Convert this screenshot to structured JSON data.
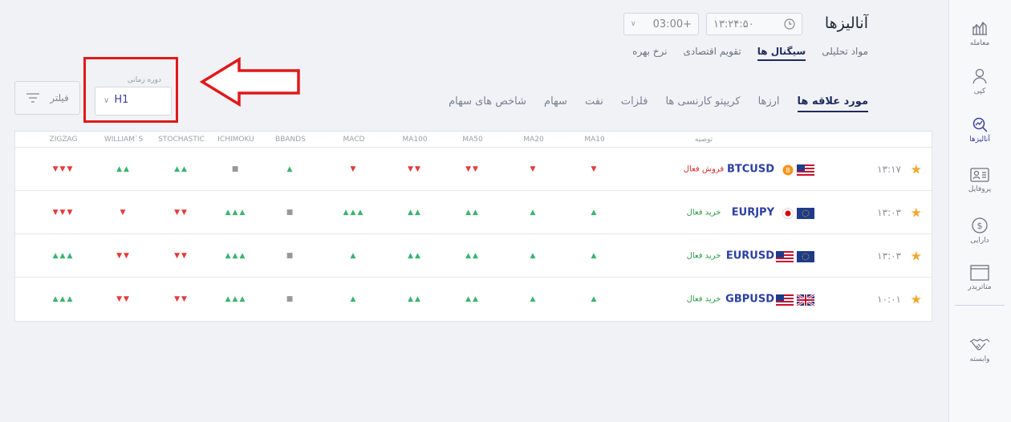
{
  "header": {
    "title": "آنالیزها",
    "clock": "۱۳:۲۴:۵۰",
    "timezone": "03:00+"
  },
  "top_tabs": [
    "مواد تحلیلی",
    "سیگنال ها",
    "تقویم اقتصادی",
    "نرخ بهره"
  ],
  "category_tabs": [
    "مورد علاقه ها",
    "ارزها",
    "کریپتو کارنسی ها",
    "فلزات",
    "نفت",
    "سهام",
    "شاخص های سهام"
  ],
  "filter": {
    "label": "فیلتر"
  },
  "period": {
    "label": "دوره زمانی",
    "value": "H1"
  },
  "table": {
    "headers": {
      "recommendation": "توصیه",
      "ma10": "MA10",
      "ma20": "MA20",
      "ma50": "MA50",
      "ma100": "MA100",
      "macd": "MACD",
      "bbands": "BBANDS",
      "ichimoku": "ICHIMOKU",
      "stochastic": "STOCHASTIC",
      "williams": "WILLIAM`S",
      "zigzag": "ZIGZAG"
    },
    "rows": [
      {
        "time": "۱۳:۱۷",
        "symbol": "BTCUSD",
        "flags": [
          "us",
          "btc"
        ],
        "recommendation": "فروش فعال",
        "rec_type": "sell",
        "signals": {
          "ma10": "▼",
          "ma20": "▼",
          "ma50": "▼▼",
          "ma100": "▼▼",
          "macd": "▼",
          "bbands": "▲",
          "ichimoku": "■",
          "stochastic": "▲▲",
          "williams": "▲▲",
          "zigzag": "▼▼▼"
        }
      },
      {
        "time": "۱۳:۰۳",
        "symbol": "EURJPY",
        "flags": [
          "eu",
          "jp"
        ],
        "recommendation": "خرید فعال",
        "rec_type": "buy",
        "signals": {
          "ma10": "▲",
          "ma20": "▲",
          "ma50": "▲▲",
          "ma100": "▲▲",
          "macd": "▲▲▲",
          "bbands": "■",
          "ichimoku": "▲▲▲",
          "stochastic": "▼▼",
          "williams": "▼",
          "zigzag": "▼▼▼"
        }
      },
      {
        "time": "۱۳:۰۳",
        "symbol": "EURUSD",
        "flags": [
          "eu",
          "us"
        ],
        "recommendation": "خرید فعال",
        "rec_type": "buy",
        "signals": {
          "ma10": "▲",
          "ma20": "▲",
          "ma50": "▲▲",
          "ma100": "▲▲",
          "macd": "▲",
          "bbands": "■",
          "ichimoku": "▲▲▲",
          "stochastic": "▼▼",
          "williams": "▼▼",
          "zigzag": "▲▲▲"
        }
      },
      {
        "time": "۱۰:۰۱",
        "symbol": "GBPUSD",
        "flags": [
          "gb",
          "us"
        ],
        "recommendation": "خرید فعال",
        "rec_type": "buy",
        "signals": {
          "ma10": "▲",
          "ma20": "▲",
          "ma50": "▲▲",
          "ma100": "▲▲",
          "macd": "▲",
          "bbands": "■",
          "ichimoku": "▲▲▲",
          "stochastic": "▼▼",
          "williams": "▼▼",
          "zigzag": "▲▲▲"
        }
      }
    ]
  },
  "sidebar": [
    {
      "label": "معامله",
      "icon": "chart-icon"
    },
    {
      "label": "کپی",
      "icon": "copy-user-icon"
    },
    {
      "label": "آنالیزها",
      "icon": "analysis-icon"
    },
    {
      "label": "پروفایل",
      "icon": "profile-card-icon"
    },
    {
      "label": "دارایی",
      "icon": "dollar-icon"
    },
    {
      "label": "متاتریدر",
      "icon": "window-icon"
    },
    {
      "label": "وابسته",
      "icon": "handshake-icon"
    }
  ],
  "colors": {
    "up": "#3cb371",
    "down": "#e23b3b",
    "sell": "#d42a2a",
    "buy": "#2e9a48",
    "accent": "#2c3fa0",
    "star": "#f0a830",
    "annotation": "#e01a1a"
  }
}
